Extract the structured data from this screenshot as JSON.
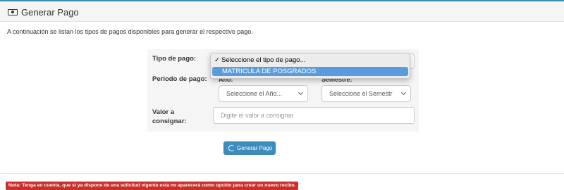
{
  "panel": {
    "title": "Generar Pago",
    "icon": "money-icon"
  },
  "intro": "A continuación se listan los tipos de pagos disponibles para generar el respectivo pago.",
  "form": {
    "tipo_label": "Tipo de pago:",
    "tipo_options": [
      "Seleccione el tipo de pago...",
      "MATRICULA DE POSGRADOS"
    ],
    "tipo_selected_check": "✓",
    "periodo_label": "Periodo de pago:",
    "anio_label": "Año:",
    "anio_select": "Seleccione el Año...",
    "semestre_label": "Semestre:",
    "semestre_select": "Seleccione el Semestr",
    "valor_label": "Valor a consignar:",
    "valor_placeholder": "Digite el valor a consignar"
  },
  "button": {
    "label": "Generar Pago",
    "icon": "refresh-icon"
  },
  "note": "Nota: Tenga en cuenta, que si ya dispone de una solicitud vigente esta no aparecerá como opción para crear un nuevo recibo.",
  "colors": {
    "primary": "#3c8dbc",
    "danger": "#c9302c",
    "highlight": "#5a9bdb"
  }
}
